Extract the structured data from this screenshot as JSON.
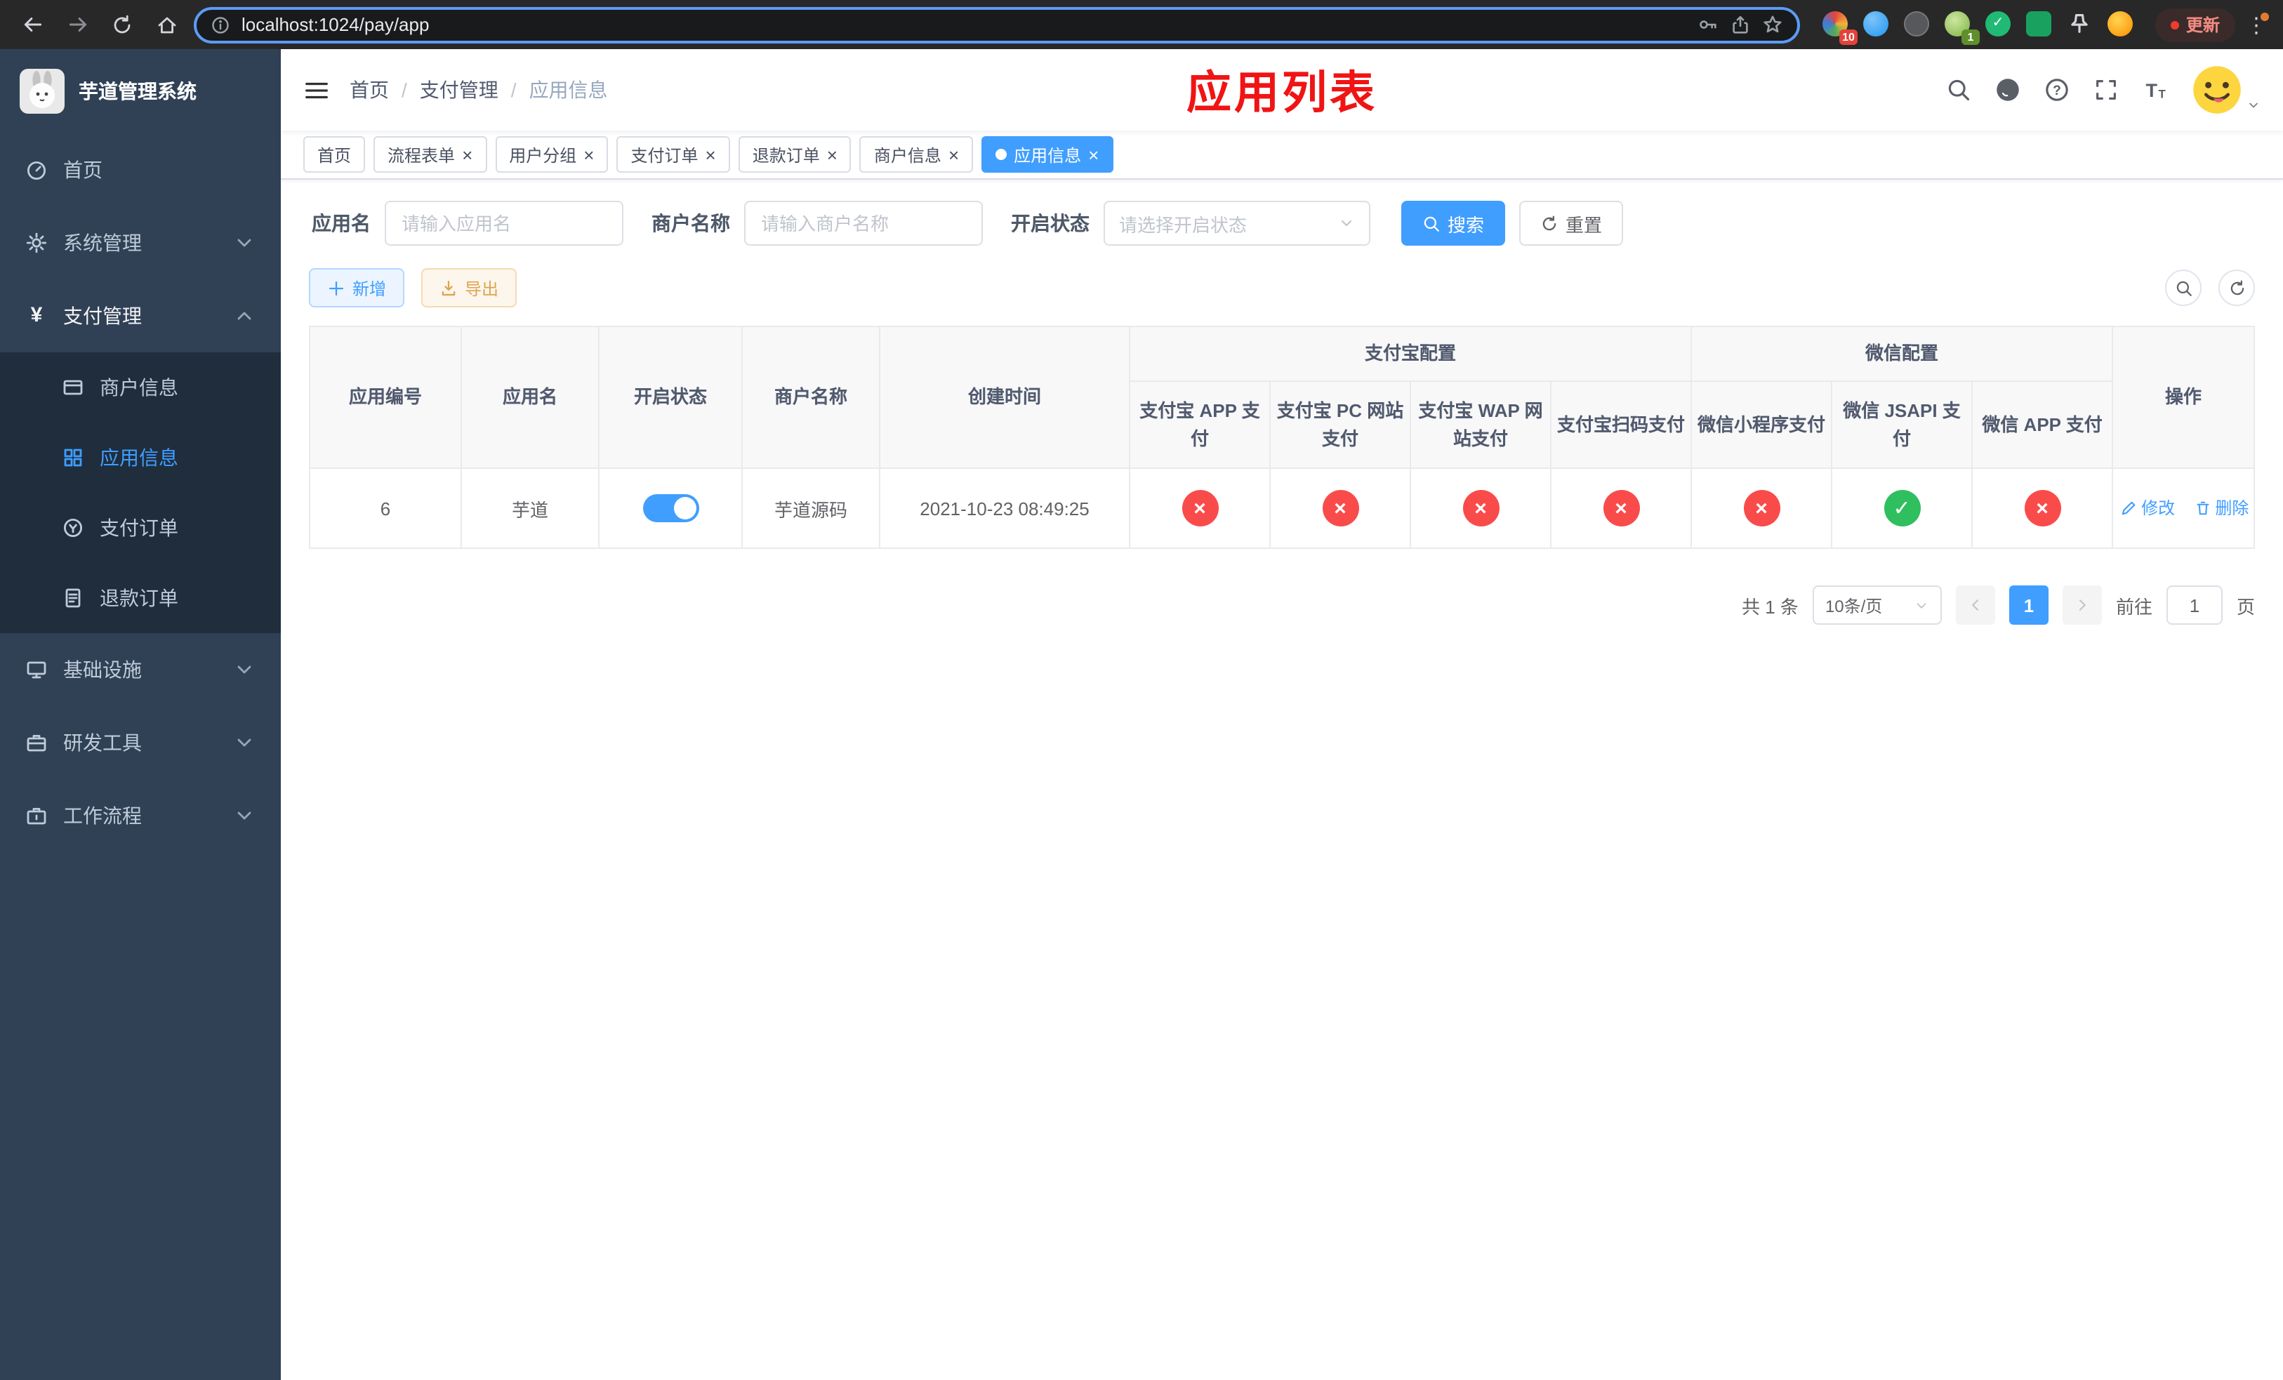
{
  "browser": {
    "url": "localhost:1024/pay/app",
    "update_label": "更新",
    "ext_badge_1": "10",
    "ext_badge_2": "1"
  },
  "sidebar": {
    "title": "芋道管理系统",
    "menu": [
      {
        "label": "首页"
      },
      {
        "label": "系统管理"
      },
      {
        "label": "支付管理"
      },
      {
        "label": "商户信息"
      },
      {
        "label": "应用信息"
      },
      {
        "label": "支付订单"
      },
      {
        "label": "退款订单"
      },
      {
        "label": "基础设施"
      },
      {
        "label": "研发工具"
      },
      {
        "label": "工作流程"
      }
    ]
  },
  "header": {
    "breadcrumb": [
      "首页",
      "支付管理",
      "应用信息"
    ],
    "banner": "应用列表"
  },
  "tabs": [
    {
      "label": "首页"
    },
    {
      "label": "流程表单"
    },
    {
      "label": "用户分组"
    },
    {
      "label": "支付订单"
    },
    {
      "label": "退款订单"
    },
    {
      "label": "商户信息"
    },
    {
      "label": "应用信息"
    }
  ],
  "filters": {
    "app_name_label": "应用名",
    "app_name_placeholder": "请输入应用名",
    "merchant_label": "商户名称",
    "merchant_placeholder": "请输入商户名称",
    "status_label": "开启状态",
    "status_placeholder": "请选择开启状态",
    "search": "搜索",
    "reset": "重置"
  },
  "toolbar": {
    "add": "新增",
    "export": "导出"
  },
  "table": {
    "col_id": "应用编号",
    "col_name": "应用名",
    "col_status": "开启状态",
    "col_merchant": "商户名称",
    "col_created": "创建时间",
    "group_alipay": "支付宝配置",
    "group_wechat": "微信配置",
    "col_alipay_app": "支付宝 APP 支付",
    "col_alipay_pc": "支付宝 PC 网站支付",
    "col_alipay_wap": "支付宝 WAP 网站支付",
    "col_alipay_qr": "支付宝扫码支付",
    "col_wx_lite": "微信小程序支付",
    "col_wx_jsapi": "微信 JSAPI 支付",
    "col_wx_app": "微信 APP 支付",
    "col_action": "操作",
    "row": {
      "id": "6",
      "name": "芋道",
      "enabled": true,
      "merchant": "芋道源码",
      "created": "2021-10-23 08:49:25",
      "statuses": [
        false,
        false,
        false,
        false,
        false,
        true,
        false
      ],
      "edit": "修改",
      "delete": "删除"
    }
  },
  "pagination": {
    "total": "共 1 条",
    "page_size": "10条/页",
    "page": "1",
    "goto_label": "前往",
    "goto_value": "1",
    "goto_suffix": "页"
  },
  "colors": {
    "accent": "#409eff",
    "danger": "#fa4b4b",
    "success": "#2fbf5f",
    "warning": "#dda450",
    "banner": "#f01414",
    "sidebar_bg": "#304156",
    "submenu_bg": "#1f2d3d"
  }
}
